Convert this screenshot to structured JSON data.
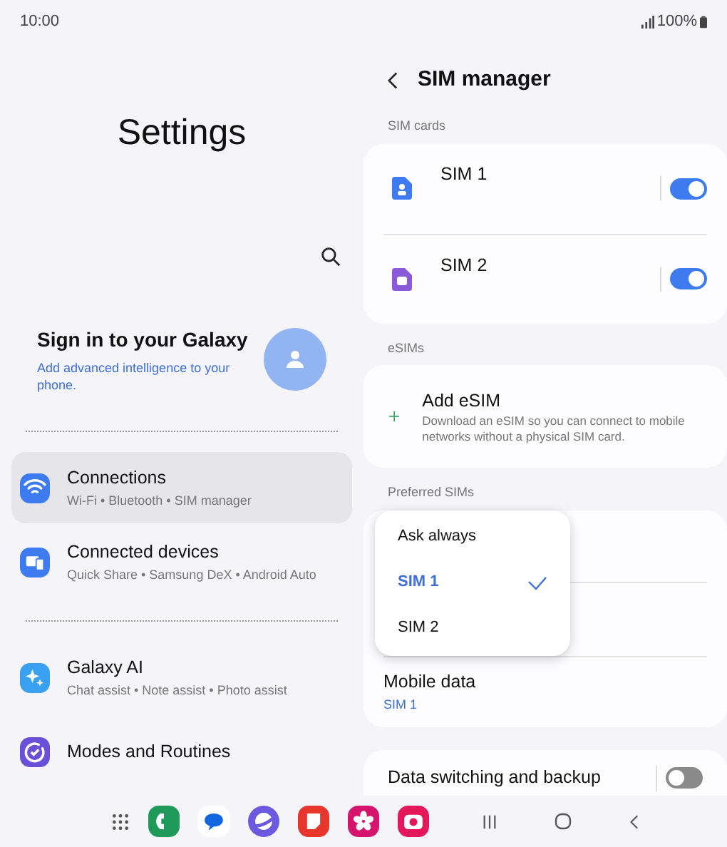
{
  "status_bar": {
    "time": "10:00",
    "battery": "100%"
  },
  "settings": {
    "title": "Settings",
    "account": {
      "title": "Sign in to your Galaxy",
      "subtitle": "Add advanced intelligence to your phone."
    },
    "groups": [
      [
        {
          "kind": "wifi",
          "label": "Connections",
          "summary": "Wi-Fi  •  Bluetooth  •  SIM manager",
          "selected": true
        },
        {
          "kind": "devices",
          "label": "Connected devices",
          "summary": "Quick Share  •  Samsung DeX  •  Android Auto",
          "selected": false
        }
      ],
      [
        {
          "kind": "ai",
          "label": "Galaxy AI",
          "summary": "Chat assist  •  Note assist  •  Photo assist",
          "selected": false
        },
        {
          "kind": "modes",
          "label": "Modes and Routines",
          "selected": false
        }
      ]
    ]
  },
  "sim_manager": {
    "title": "SIM manager",
    "sim_cards": {
      "heading": "SIM cards",
      "items": [
        {
          "kind": "sim1",
          "label": "SIM 1",
          "on": true
        },
        {
          "kind": "sim2",
          "label": "SIM 2",
          "on": true
        }
      ]
    },
    "esims": {
      "heading": "eSIMs",
      "add": {
        "label": "Add eSIM",
        "description": "Download an eSIM so you can connect to mobile networks without a physical SIM card."
      }
    },
    "preferred": {
      "heading": "Preferred SIMs",
      "options": [
        {
          "label": "Ask always",
          "selected": false
        },
        {
          "label": "SIM 1",
          "selected": true
        },
        {
          "label": "SIM 2",
          "selected": false
        }
      ],
      "mobile_data": {
        "label": "Mobile data",
        "value": "SIM 1"
      }
    },
    "data_switching": {
      "label": "Data switching and backup",
      "on": false
    }
  },
  "taskbar": {
    "apps": [
      {
        "kind": "grid"
      },
      {
        "kind": "phone"
      },
      {
        "kind": "messages"
      },
      {
        "kind": "browser"
      },
      {
        "kind": "notes"
      },
      {
        "kind": "flower"
      },
      {
        "kind": "camera"
      }
    ]
  }
}
